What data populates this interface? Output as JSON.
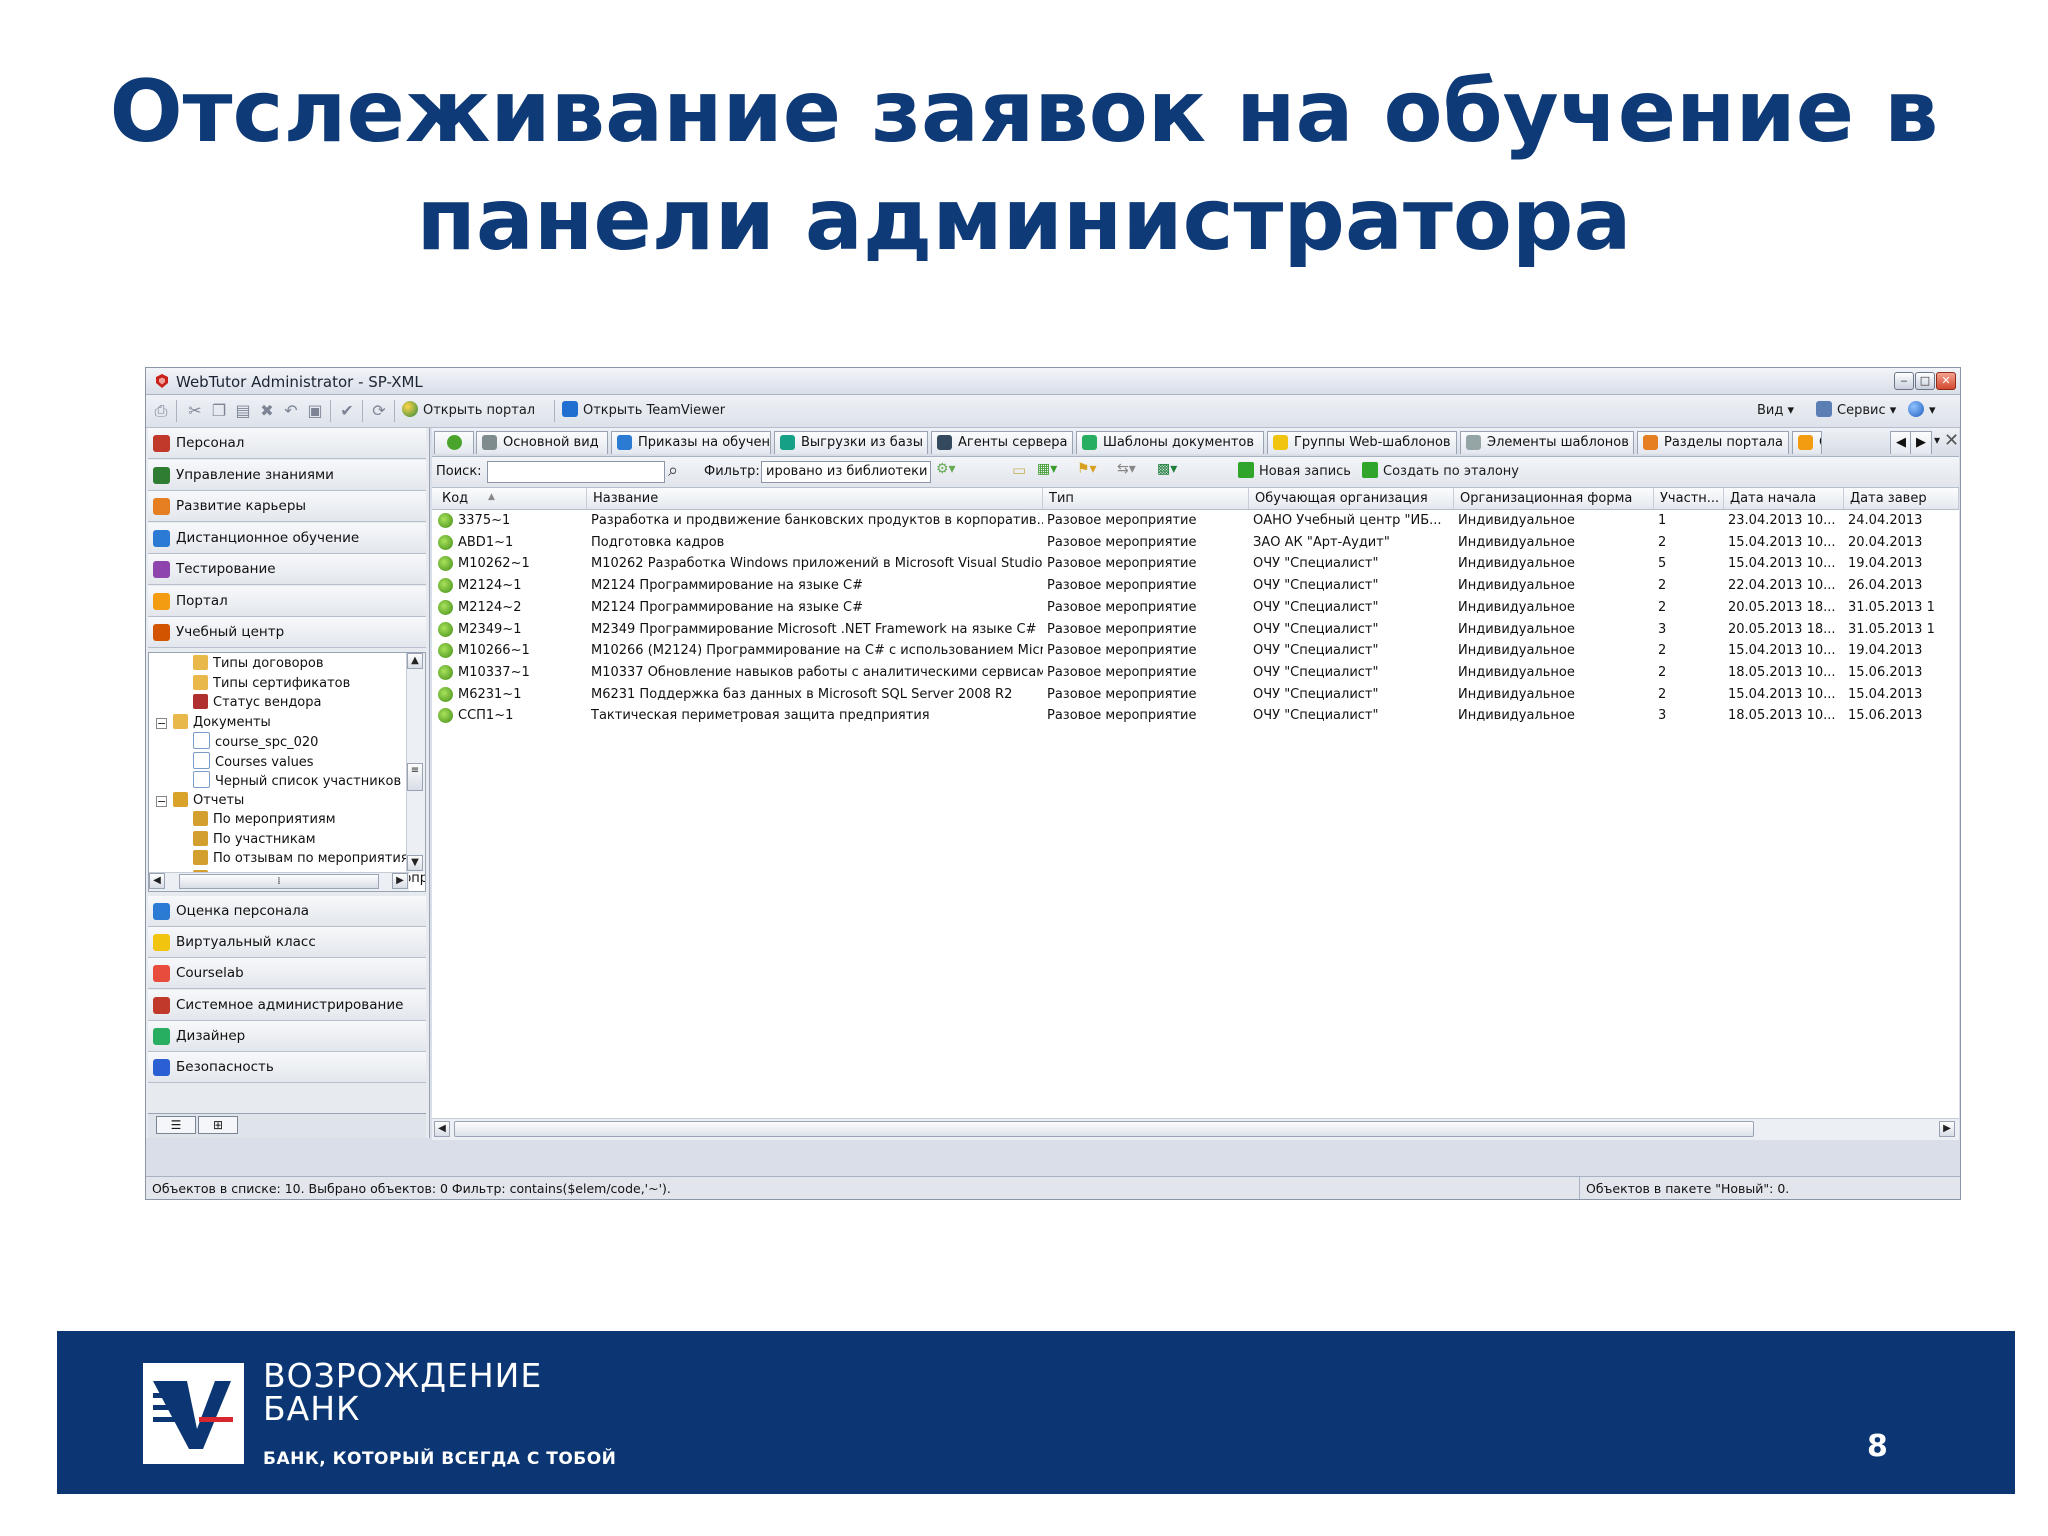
{
  "slide": {
    "title_line1": "Отслеживание заявок на обучение в",
    "title_line2": "панели администратора",
    "page_number": "8"
  },
  "window": {
    "title": "WebTutor Administrator - SP-XML",
    "controls": {
      "minimize": "‒",
      "maximize": "□",
      "close": "✕"
    }
  },
  "toolbar": {
    "open_portal": "Открыть портал",
    "open_teamviewer": "Открыть TeamViewer",
    "view_menu": "Вид",
    "service_menu": "Сервис"
  },
  "sidebar": {
    "nav_top": [
      {
        "label": "Персонал",
        "icon": "people-icon",
        "color": "#c0392b"
      },
      {
        "label": "Управление знаниями",
        "icon": "book-icon",
        "color": "#2e7d32"
      },
      {
        "label": "Развитие карьеры",
        "icon": "career-icon",
        "color": "#e67e22"
      },
      {
        "label": "Дистанционное обучение",
        "icon": "globe-icon",
        "color": "#2b7bd4"
      },
      {
        "label": "Тестирование",
        "icon": "test-icon",
        "color": "#8e44ad"
      },
      {
        "label": "Портал",
        "icon": "portal-icon",
        "color": "#f39c12"
      },
      {
        "label": "Учебный центр",
        "icon": "school-icon",
        "color": "#d35400"
      }
    ],
    "tree": [
      {
        "label": "Типы договоров",
        "level": 2,
        "icon": "folder-icon"
      },
      {
        "label": "Типы сертификатов",
        "level": 2,
        "icon": "folder-icon"
      },
      {
        "label": "Статус вендора",
        "level": 2,
        "icon": "bottle-icon"
      },
      {
        "label": "Документы",
        "level": 1,
        "icon": "folder-open-icon",
        "expander": "−"
      },
      {
        "label": "course_spc_020",
        "level": 2,
        "icon": "document-icon"
      },
      {
        "label": "Courses values",
        "level": 2,
        "icon": "document-icon"
      },
      {
        "label": "Черный список участников",
        "level": 2,
        "icon": "document-icon"
      },
      {
        "label": "Отчеты",
        "level": 1,
        "icon": "reports-icon",
        "expander": "−"
      },
      {
        "label": "По мероприятиям",
        "level": 2,
        "icon": "report-icon"
      },
      {
        "label": "По участникам",
        "level": 2,
        "icon": "report-icon"
      },
      {
        "label": "По отзывам по мероприятиям",
        "level": 2,
        "icon": "report-icon"
      },
      {
        "label": "По вопросам отзыва на мероприятие",
        "level": 2,
        "icon": "report-icon"
      }
    ],
    "nav_bottom": [
      {
        "label": "Оценка персонала",
        "icon": "assessment-icon",
        "color": "#2b7bd4"
      },
      {
        "label": "Виртуальный класс",
        "icon": "sun-icon",
        "color": "#f1c40f"
      },
      {
        "label": "Courselab",
        "icon": "courselab-icon",
        "color": "#e74c3c"
      },
      {
        "label": "Системное администрирование",
        "icon": "tools-icon",
        "color": "#c0392b"
      },
      {
        "label": "Дизайнер",
        "icon": "designer-icon",
        "color": "#27ae60"
      },
      {
        "label": "Безопасность",
        "icon": "security-icon",
        "color": "#2b5fd4"
      }
    ]
  },
  "tabs": [
    {
      "label": "Основной вид",
      "icon": "main-view-icon",
      "color": "#7f8c8d"
    },
    {
      "label": "Приказы на обучение",
      "icon": "orders-icon",
      "color": "#2b7bd4"
    },
    {
      "label": "Выгрузки из базы",
      "icon": "export-icon",
      "color": "#16a085"
    },
    {
      "label": "Агенты сервера",
      "icon": "agents-icon",
      "color": "#34495e"
    },
    {
      "label": "Шаблоны документов",
      "icon": "templates-icon",
      "color": "#27ae60"
    },
    {
      "label": "Группы Web-шаблонов",
      "icon": "web-groups-icon",
      "color": "#f1c40f"
    },
    {
      "label": "Элементы шаблонов",
      "icon": "template-items-icon",
      "color": "#95a5a6"
    },
    {
      "label": "Разделы портала",
      "icon": "portal-sections-icon",
      "color": "#e67e22"
    },
    {
      "label": "Сл",
      "icon": "more-icon",
      "color": "#f39c12"
    }
  ],
  "filterbar": {
    "search_label": "Поиск:",
    "search_value": "",
    "filter_label": "Фильтр:",
    "filter_value": "ировано из библиотеки",
    "new_record": "Новая запись",
    "create_by_template": "Создать по эталону"
  },
  "grid": {
    "columns": [
      "Код",
      "Название",
      "Тип",
      "Обучающая организация",
      "Организационная форма",
      "Участн...",
      "Дата начала",
      "Дата завер"
    ],
    "rows": [
      [
        "3375~1",
        "Разработка и продвижение банковских продуктов в корпоратив...",
        "Разовое мероприятие",
        "ОАНО Учебный центр \"ИБ...",
        "Индивидуальное",
        "1",
        "23.04.2013 10...",
        "24.04.2013"
      ],
      [
        "ABD1~1",
        "Подготовка кадров",
        "Разовое мероприятие",
        "ЗАО АК \"Арт-Аудит\"",
        "Индивидуальное",
        "2",
        "15.04.2013 10...",
        "20.04.2013"
      ],
      [
        "M10262~1",
        "M10262 Разработка Windows приложений в Microsoft Visual Studio ...",
        "Разовое мероприятие",
        "ОЧУ \"Специалист\"",
        "Индивидуальное",
        "5",
        "15.04.2013 10...",
        "19.04.2013"
      ],
      [
        "M2124~1",
        "M2124 Программирование на языке C#",
        "Разовое мероприятие",
        "ОЧУ \"Специалист\"",
        "Индивидуальное",
        "2",
        "22.04.2013 10...",
        "26.04.2013"
      ],
      [
        "M2124~2",
        "M2124 Программирование на языке C#",
        "Разовое мероприятие",
        "ОЧУ \"Специалист\"",
        "Индивидуальное",
        "2",
        "20.05.2013 18...",
        "31.05.2013 1"
      ],
      [
        "M2349~1",
        "M2349 Программирование Microsoft .NET Framework на языке C#",
        "Разовое мероприятие",
        "ОЧУ \"Специалист\"",
        "Индивидуальное",
        "3",
        "20.05.2013 18...",
        "31.05.2013 1"
      ],
      [
        "M10266~1",
        "M10266 (M2124) Программирование на C# с использованием Micro...",
        "Разовое мероприятие",
        "ОЧУ \"Специалист\"",
        "Индивидуальное",
        "2",
        "15.04.2013 10...",
        "19.04.2013"
      ],
      [
        "M10337~1",
        "M10337 Обновление навыков работы с аналитическими сервисам...",
        "Разовое мероприятие",
        "ОЧУ \"Специалист\"",
        "Индивидуальное",
        "2",
        "18.05.2013 10...",
        "15.06.2013"
      ],
      [
        "M6231~1",
        "M6231 Поддержка баз данных в Microsoft SQL Server 2008 R2",
        "Разовое мероприятие",
        "ОЧУ \"Специалист\"",
        "Индивидуальное",
        "2",
        "15.04.2013 10...",
        "15.04.2013"
      ],
      [
        "ССП1~1",
        "Тактическая периметровая защита предприятия",
        "Разовое мероприятие",
        "ОЧУ \"Специалист\"",
        "Индивидуальное",
        "3",
        "18.05.2013 10...",
        "15.06.2013"
      ]
    ]
  },
  "statusbar": {
    "left": "Объектов в списке: 10. Выбрано объектов: 0  Фильтр:   contains($elem/code,'~').",
    "right": "Объектов в пакете \"Новый\": 0."
  },
  "footer": {
    "bank_name_1": "ВОЗРОЖДЕНИЕ",
    "bank_name_2": "БАНК",
    "slogan": "БАНК, КОТОРЫЙ ВСЕГДА С ТОБОЙ"
  },
  "colors": {
    "title": "#0e3a78",
    "footer_bg": "#0b3673",
    "footer_text": "#ffffff"
  }
}
